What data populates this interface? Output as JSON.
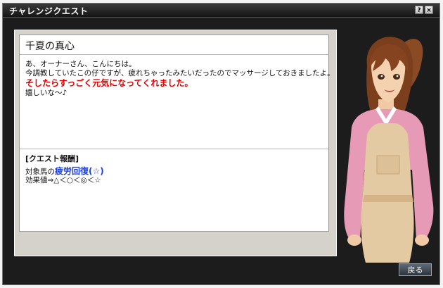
{
  "window": {
    "title": "チャレンジクエスト",
    "help_label": "?",
    "close_label": "×"
  },
  "quest": {
    "title": "千夏の真心",
    "message_lines": [
      "あ、オーナーさん、こんにちは。",
      "今調教していたこの仔ですが、疲れちゃったみたいだったのでマッサージしておきましたよ。"
    ],
    "emphasis": "そしたらすっごく元気になってくれました。",
    "closing": "嬉しいな～♪"
  },
  "reward": {
    "title": "[クエスト報酬]",
    "target_prefix": "対象馬の",
    "effect": "疲労回復(☆)",
    "value_line": "効果値⇒△＜○＜◎＜☆"
  },
  "footer": {
    "back_label": "戻る"
  },
  "character": {
    "name": "千夏"
  },
  "colors": {
    "emphasis": "#e20000",
    "effect": "#1a3fe0",
    "frame": "#1c1c1c"
  }
}
